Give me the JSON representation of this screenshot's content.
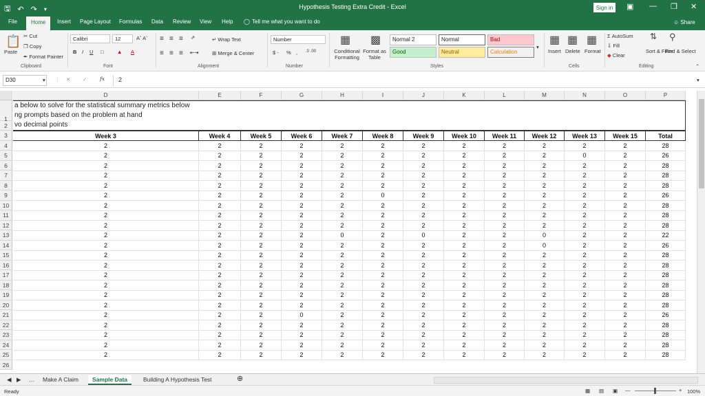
{
  "titlebar": {
    "title": "Hypothesis Testing Extra Credit  -  Excel",
    "signin": "Sign in"
  },
  "tabs": [
    "File",
    "Home",
    "Insert",
    "Page Layout",
    "Formulas",
    "Data",
    "Review",
    "View",
    "Help"
  ],
  "tell_me": "Tell me what you want to do",
  "share": "Share",
  "ribbon": {
    "clipboard": {
      "cut": "Cut",
      "copy": "Copy",
      "paste": "Paste",
      "format_painter": "Format Painter",
      "label": "Clipboard"
    },
    "font": {
      "name": "Calibri",
      "size": "12",
      "label": "Font"
    },
    "alignment": {
      "wrap": "Wrap Text",
      "merge": "Merge & Center",
      "label": "Alignment"
    },
    "number": {
      "format": "Number",
      "label": "Number"
    },
    "styles": {
      "conditional": "Conditional Formatting",
      "format_as": "Format as Table",
      "normal2": "Normal 2",
      "normal": "Normal",
      "bad": "Bad",
      "good": "Good",
      "neutral": "Neutral",
      "calculation": "Calculation",
      "label": "Styles"
    },
    "cells": {
      "insert": "Insert",
      "delete": "Delete",
      "format": "Format",
      "label": "Cells"
    },
    "editing": {
      "autosum": "AutoSum",
      "fill": "Fill",
      "clear": "Clear",
      "sort": "Sort & Filter",
      "find": "Find & Select",
      "label": "Editing"
    }
  },
  "formula_bar": {
    "name_box": "D30",
    "fx": "fx",
    "content": "2"
  },
  "columns": [
    "D",
    "E",
    "F",
    "G",
    "H",
    "I",
    "J",
    "K",
    "L",
    "M",
    "N",
    "O",
    "P"
  ],
  "note_lines": [
    "a below to solve for the statistical summary metrics below",
    "ng prompts based on the problem at hand",
    "vo decimal points"
  ],
  "headers": [
    "Week 3",
    "Week 4",
    "Week 5",
    "Week 6",
    "Week 7",
    "Week 8",
    "Week 9",
    "Week 10",
    "Week 11",
    "Week 12",
    "Week 13",
    "Week 15",
    "Total"
  ],
  "row_numbers": [
    "1",
    "2",
    "3",
    "4",
    "5",
    "6",
    "7",
    "8",
    "9",
    "10",
    "11",
    "12",
    "13",
    "14",
    "15",
    "16",
    "17",
    "18",
    "19",
    "20",
    "21",
    "22",
    "23",
    "24",
    "25",
    "26"
  ],
  "rows": [
    [
      "2",
      "2",
      "2",
      "2",
      "2",
      "2",
      "2",
      "2",
      "2",
      "2",
      "2",
      "2",
      "28"
    ],
    [
      "2",
      "2",
      "2",
      "2",
      "2",
      "2",
      "2",
      "2",
      "2",
      "2",
      "0",
      "2",
      "26"
    ],
    [
      "2",
      "2",
      "2",
      "2",
      "2",
      "2",
      "2",
      "2",
      "2",
      "2",
      "2",
      "2",
      "28"
    ],
    [
      "2",
      "2",
      "2",
      "2",
      "2",
      "2",
      "2",
      "2",
      "2",
      "2",
      "2",
      "2",
      "28"
    ],
    [
      "2",
      "2",
      "2",
      "2",
      "2",
      "2",
      "2",
      "2",
      "2",
      "2",
      "2",
      "2",
      "28"
    ],
    [
      "2",
      "2",
      "2",
      "2",
      "2",
      "0",
      "2",
      "2",
      "2",
      "2",
      "2",
      "2",
      "26"
    ],
    [
      "2",
      "2",
      "2",
      "2",
      "2",
      "2",
      "2",
      "2",
      "2",
      "2",
      "2",
      "2",
      "28"
    ],
    [
      "2",
      "2",
      "2",
      "2",
      "2",
      "2",
      "2",
      "2",
      "2",
      "2",
      "2",
      "2",
      "28"
    ],
    [
      "2",
      "2",
      "2",
      "2",
      "2",
      "2",
      "2",
      "2",
      "2",
      "2",
      "2",
      "2",
      "28"
    ],
    [
      "2",
      "2",
      "2",
      "2",
      "0",
      "2",
      "0",
      "2",
      "2",
      "0",
      "2",
      "2",
      "22"
    ],
    [
      "2",
      "2",
      "2",
      "2",
      "2",
      "2",
      "2",
      "2",
      "2",
      "0",
      "2",
      "2",
      "26"
    ],
    [
      "2",
      "2",
      "2",
      "2",
      "2",
      "2",
      "2",
      "2",
      "2",
      "2",
      "2",
      "2",
      "28"
    ],
    [
      "2",
      "2",
      "2",
      "2",
      "2",
      "2",
      "2",
      "2",
      "2",
      "2",
      "2",
      "2",
      "28"
    ],
    [
      "2",
      "2",
      "2",
      "2",
      "2",
      "2",
      "2",
      "2",
      "2",
      "2",
      "2",
      "2",
      "28"
    ],
    [
      "2",
      "2",
      "2",
      "2",
      "2",
      "2",
      "2",
      "2",
      "2",
      "2",
      "2",
      "2",
      "28"
    ],
    [
      "2",
      "2",
      "2",
      "2",
      "2",
      "2",
      "2",
      "2",
      "2",
      "2",
      "2",
      "2",
      "28"
    ],
    [
      "2",
      "2",
      "2",
      "2",
      "2",
      "2",
      "2",
      "2",
      "2",
      "2",
      "2",
      "2",
      "28"
    ],
    [
      "2",
      "2",
      "2",
      "0",
      "2",
      "2",
      "2",
      "2",
      "2",
      "2",
      "2",
      "2",
      "26"
    ],
    [
      "2",
      "2",
      "2",
      "2",
      "2",
      "2",
      "2",
      "2",
      "2",
      "2",
      "2",
      "2",
      "28"
    ],
    [
      "2",
      "2",
      "2",
      "2",
      "2",
      "2",
      "2",
      "2",
      "2",
      "2",
      "2",
      "2",
      "28"
    ],
    [
      "2",
      "2",
      "2",
      "2",
      "2",
      "2",
      "2",
      "2",
      "2",
      "2",
      "2",
      "2",
      "28"
    ],
    [
      "2",
      "2",
      "2",
      "2",
      "2",
      "2",
      "2",
      "2",
      "2",
      "2",
      "2",
      "2",
      "28"
    ]
  ],
  "sheets": [
    "Make A Claim",
    "Sample Data",
    "Building A Hypothesis Test"
  ],
  "active_sheet": "Sample Data",
  "status": {
    "ready": "Ready",
    "zoom": "100%"
  },
  "colors": {
    "excel_green": "#217346",
    "bad_fill": "#ffc7ce",
    "good_fill": "#c6efce",
    "neutral_fill": "#ffeb9c"
  }
}
